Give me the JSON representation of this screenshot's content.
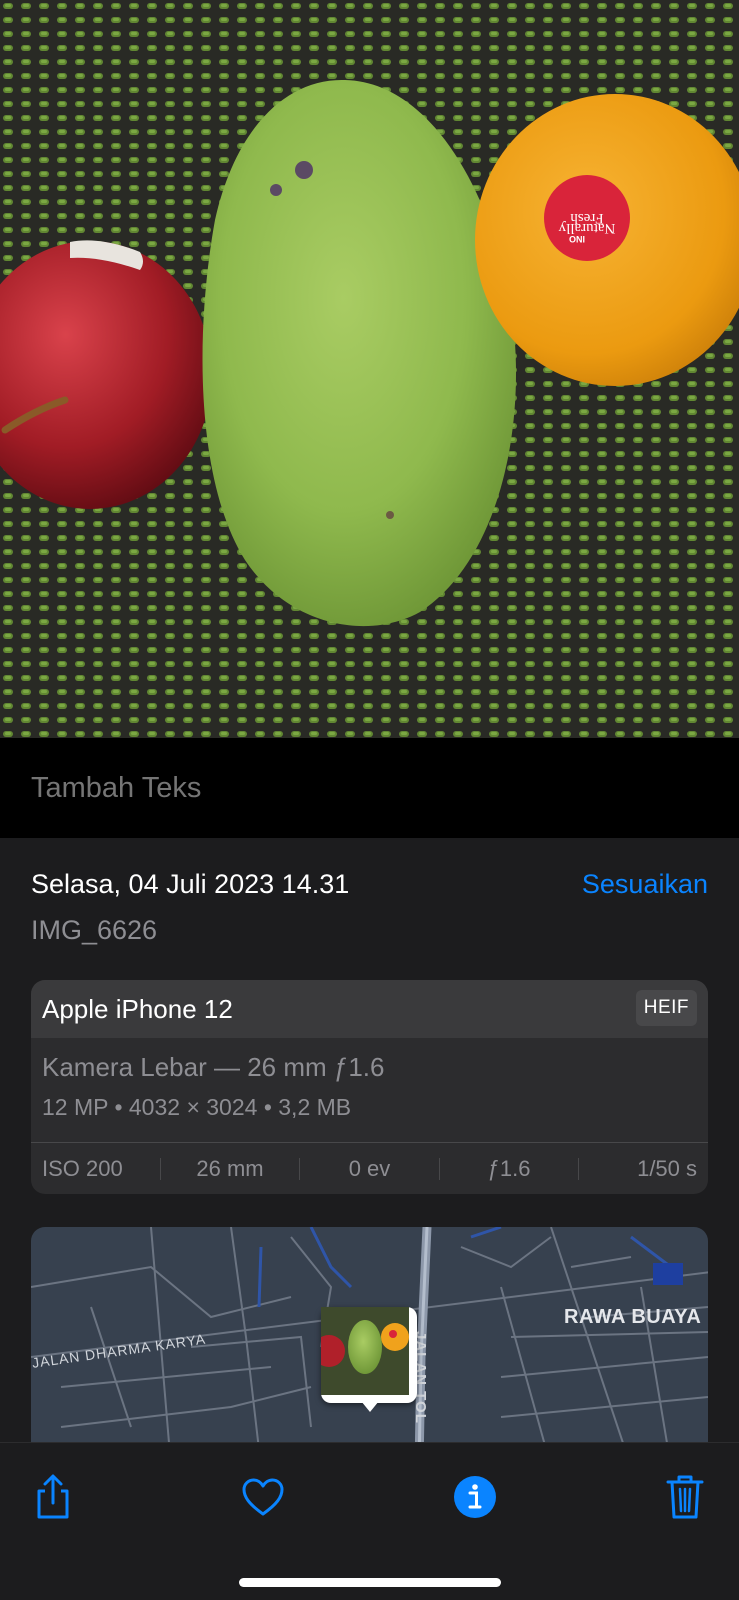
{
  "caption": {
    "placeholder": "Tambah Teks"
  },
  "info": {
    "date": "Selasa, 04 Juli 2023 14.31",
    "adjust_label": "Sesuaikan",
    "filename": "IMG_6626"
  },
  "camera": {
    "device": "Apple iPhone 12",
    "format_badge": "HEIF",
    "lens": "Kamera Lebar — 26 mm ƒ1.6",
    "specs": "12 MP  •  4032 × 3024  •  3,2 MB",
    "exif": [
      "ISO 200",
      "26 mm",
      "0 ev",
      "ƒ1.6",
      "1/50 s"
    ]
  },
  "map": {
    "labels": {
      "area": "RAWA BUAYA",
      "road": "JALAN DHARMA KARYA",
      "highway": "JALAN TOL"
    }
  },
  "photo_sticker": {
    "line1": "Naturally",
    "line2": "Fresh",
    "brand": "INO"
  },
  "toolbar": {
    "icons": [
      "share-icon",
      "heart-icon",
      "info-icon",
      "trash-icon"
    ],
    "accent": "#0a84ff"
  }
}
